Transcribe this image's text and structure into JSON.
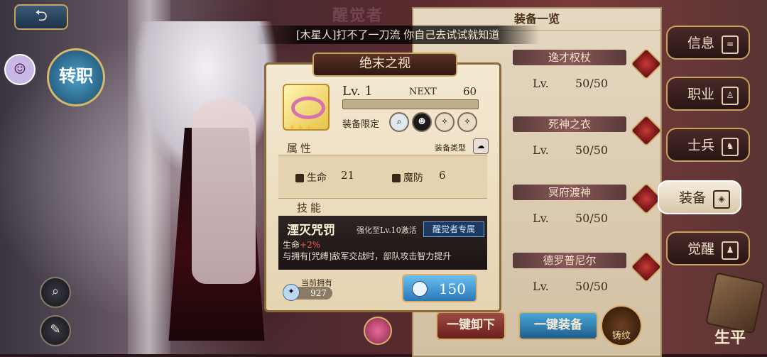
{
  "header": {
    "screen_title": "醒觉者",
    "banner_text": "[木星人]打不了一刀流 你自己去试试就知道",
    "back_icon": "back-arrow-icon"
  },
  "left": {
    "transfer_label": "转职",
    "zoom_icon": "magnifier-icon",
    "feather_icon": "feather-icon"
  },
  "equip_panel": {
    "title": "装备一览",
    "lv_prefix": "Lv.",
    "items": [
      {
        "name": "逸才权杖",
        "level": "50/50"
      },
      {
        "name": "死神之衣",
        "level": "50/50"
      },
      {
        "name": "冥府渡神",
        "level": "50/50"
      },
      {
        "name": "德罗普尼尔",
        "level": "50/50"
      }
    ],
    "unequip_label": "一键卸下",
    "equip_all_label": "一键装备",
    "inscribe_label": "铸纹"
  },
  "side_tabs": [
    {
      "label": "信息",
      "icon": "document-icon"
    },
    {
      "label": "职业",
      "icon": "person-icon"
    },
    {
      "label": "士兵",
      "icon": "soldier-icon"
    },
    {
      "label": "装备",
      "icon": "shield-icon",
      "active": true
    },
    {
      "label": "觉醒",
      "icon": "awaken-icon"
    }
  ],
  "career_label": "生平",
  "detail": {
    "name": "绝末之视",
    "stars": "★★★",
    "level_text": "Lv. 1",
    "next_label": "NEXT",
    "next_value": "60",
    "exp_progress": 0,
    "restrict_label": "装备限定",
    "equip_type_label": "装备类型",
    "attr_section": "属性",
    "attrs": [
      {
        "label": "生命",
        "value": "21"
      },
      {
        "label": "魔防",
        "value": "6"
      }
    ],
    "skill_section": "技能",
    "skill": {
      "name": "湮灭咒罚",
      "condition": "强化至Lv.10激活",
      "tag": "醒觉者专属",
      "stat_label": "生命",
      "stat_value": "+2%",
      "description": "与拥有[咒缚]敌军交战时，部队攻击智力提升"
    },
    "owned_label": "当前拥有",
    "owned_value": "927",
    "cost_value": "150"
  }
}
